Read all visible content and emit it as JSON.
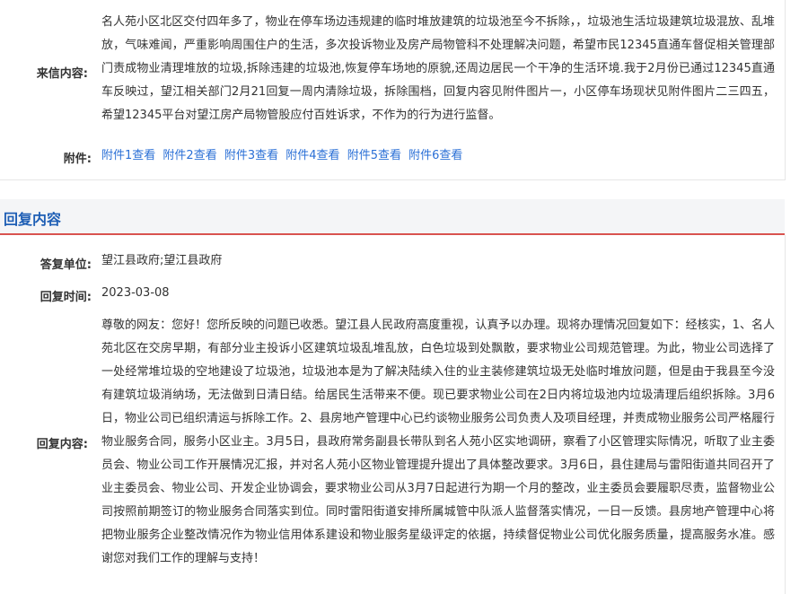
{
  "letter": {
    "content_label": "来信内容:",
    "content_text": "名人苑小区北区交付四年多了，物业在停车场边违规建的临时堆放建筑的垃圾池至今不拆除，，垃圾池生活垃圾建筑垃圾混放、乱堆放，气味难闻，严重影响周围住户的生活，多次投诉物业及房产局物管科不处理解决问题，希望市民12345直通车督促相关管理部门责成物业清理堆放的垃圾,拆除违建的垃圾池,恢复停车场地的原貌,还周边居民一个干净的生活环境.我于2月份已通过12345直通车反映过，望江相关部门2月21回复一周内清除垃圾，拆除围档，回复内容见附件图片一，小区停车场现状见附件图片二三四五，希望12345平台对望江房产局物管股应付百姓诉求，不作为的行为进行监督。",
    "attachments_label": "附件:",
    "attachments": [
      "附件1查看",
      "附件2查看",
      "附件3查看",
      "附件4查看",
      "附件5查看",
      "附件6查看"
    ]
  },
  "reply": {
    "section_title": "回复内容",
    "unit_label": "答复单位:",
    "unit_value": "望江县政府;望江县政府",
    "time_label": "回复时间:",
    "time_value": "2023-03-08",
    "content_label": "回复内容:",
    "content_text": "尊敬的网友：您好！您所反映的问题已收悉。望江县人民政府高度重视，认真予以办理。现将办理情况回复如下：经核实，1、名人苑北区在交房早期，有部分业主投诉小区建筑垃圾乱堆乱放，白色垃圾到处飘散，要求物业公司规范管理。为此，物业公司选择了一处经常堆垃圾的空地建设了垃圾池，垃圾池本是为了解决陆续入住的业主装修建筑垃圾无处临时堆放问题，但是由于我县至今没有建筑垃圾消纳场，无法做到日清日结。给居民生活带来不便。现已要求物业公司在2日内将垃圾池内垃圾清理后组织拆除。3月6日，物业公司已组织清运与拆除工作。2、县房地产管理中心已约谈物业服务公司负责人及项目经理，并责成物业服务公司严格履行物业服务合同，服务小区业主。3月5日，县政府常务副县长带队到名人苑小区实地调研，察看了小区管理实际情况，听取了业主委员会、物业公司工作开展情况汇报，并对名人苑小区物业管理提升提出了具体整改要求。3月6日，县住建局与雷阳街道共同召开了业主委员会、物业公司、开发企业协调会，要求物业公司从3月7日起进行为期一个月的整改，业主委员会要履职尽责，监督物业公司按照前期签订的物业服务合同落实到位。同时雷阳街道安排所属城管中队派人监督落实情况，一日一反馈。县房地产管理中心将把物业服务企业整改情况作为物业信用体系建设和物业服务星级评定的依据，持续督促物业公司优化服务质量，提高服务水准。感谢您对我们工作的理解与支持！"
  }
}
